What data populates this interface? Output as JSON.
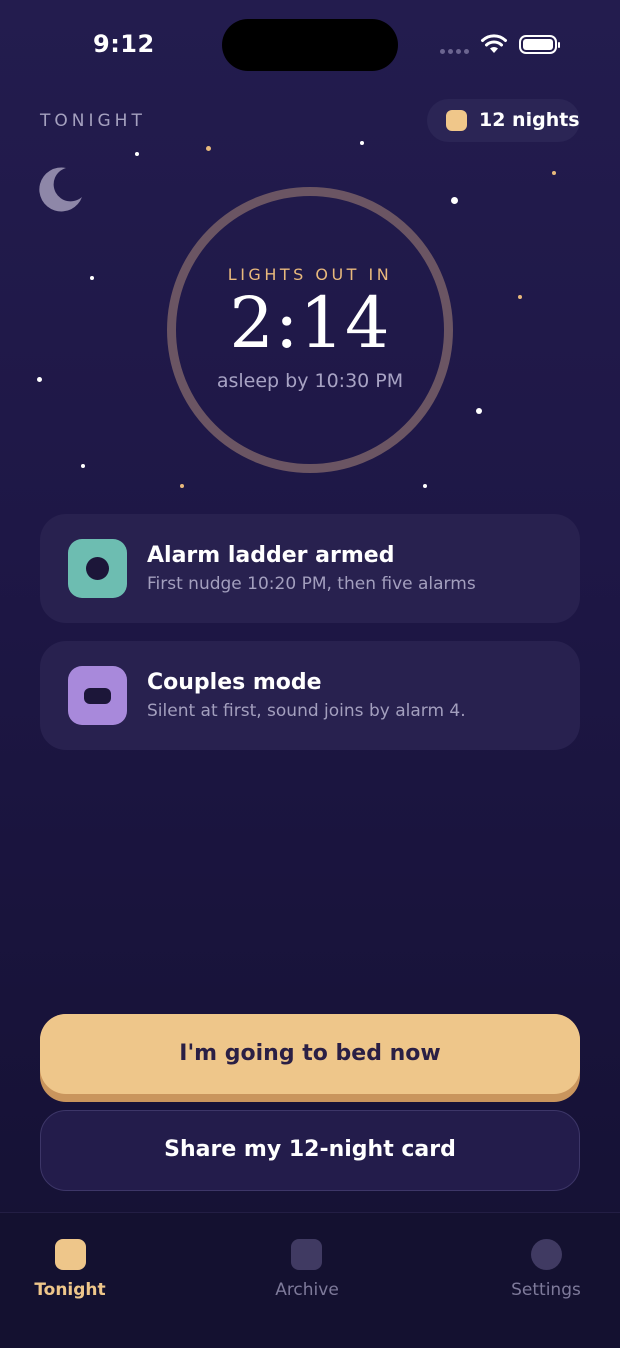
{
  "status_bar": {
    "time": "9:12"
  },
  "header": {
    "label": "TONIGHT",
    "nights_badge": "12 nights"
  },
  "countdown": {
    "label": "LIGHTS OUT IN",
    "time": "2:14",
    "subtext": "asleep by 10:30 PM"
  },
  "cards": [
    {
      "title": "Alarm ladder armed",
      "subtitle": "First nudge 10:20 PM, then five alarms",
      "icon": "alarm-dot-icon",
      "icon_color": "#6dbdb1"
    },
    {
      "title": "Couples mode",
      "subtitle": "Silent at first, sound joins by alarm 4.",
      "icon": "couples-pill-icon",
      "icon_color": "#a889db"
    }
  ],
  "actions": {
    "primary": "I'm going to bed now",
    "secondary": "Share my 12-night card"
  },
  "tabs": [
    {
      "label": "Tonight",
      "icon": "tonight-icon",
      "active": true
    },
    {
      "label": "Archive",
      "icon": "archive-icon",
      "active": false
    },
    {
      "label": "Settings",
      "icon": "settings-icon",
      "active": false
    }
  ],
  "colors": {
    "accent": "#eec68a",
    "ring": "#6b5563",
    "teal": "#6dbdb1",
    "lavender": "#a889db",
    "background": "#1e1746"
  }
}
